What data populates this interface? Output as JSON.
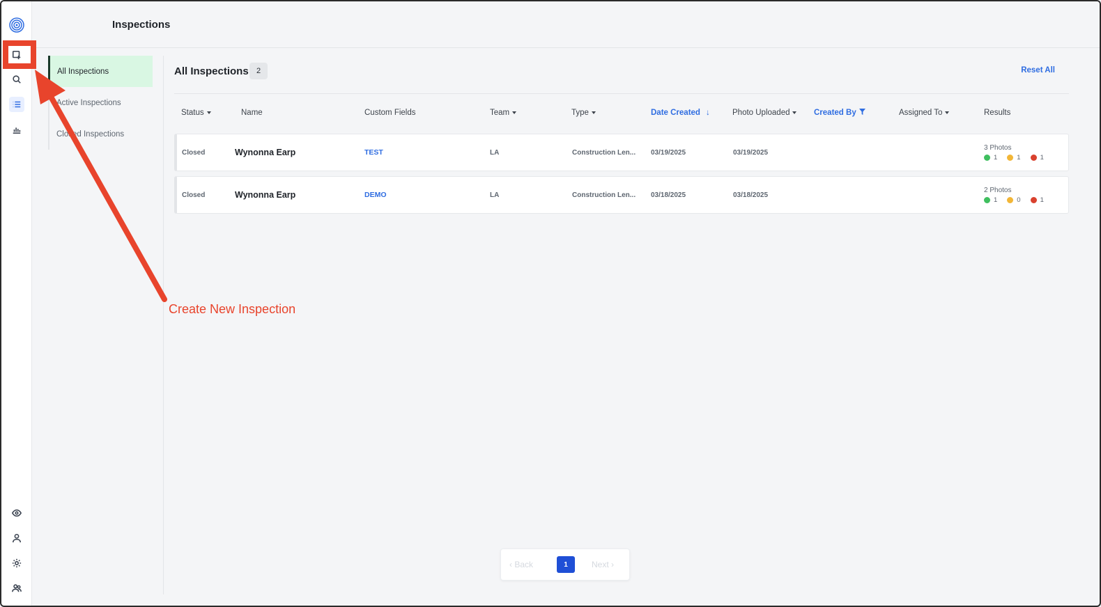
{
  "header": {
    "title": "Inspections"
  },
  "rail": {
    "icons": [
      "logo-icon",
      "create-inspection-icon",
      "search-icon",
      "list-icon",
      "chart-icon",
      "eye-icon",
      "user-icon",
      "gear-icon",
      "team-icon"
    ]
  },
  "subnav": {
    "items": [
      {
        "label": "All Inspections",
        "active": true
      },
      {
        "label": "Active Inspections",
        "active": false
      },
      {
        "label": "Closed Inspections",
        "active": false
      }
    ]
  },
  "main": {
    "heading": "All Inspections",
    "count": "2",
    "reset_label": "Reset All"
  },
  "table": {
    "columns": [
      "Status",
      "Name",
      "Custom Fields",
      "Team",
      "Type",
      "Date Created",
      "Photo Uploaded",
      "Created By",
      "Assigned To",
      "Results"
    ],
    "rows": [
      {
        "status": "Closed",
        "name": "Wynonna Earp",
        "custom_field": "TEST",
        "team": "LA",
        "type": "Construction Len...",
        "date_created": "03/19/2025",
        "photo_uploaded": "03/19/2025",
        "created_by": "",
        "assigned_to": "",
        "photos": "3 Photos",
        "green": "1",
        "yellow": "1",
        "red": "1"
      },
      {
        "status": "Closed",
        "name": "Wynonna Earp",
        "custom_field": "DEMO",
        "team": "LA",
        "type": "Construction Len...",
        "date_created": "03/18/2025",
        "photo_uploaded": "03/18/2025",
        "created_by": "",
        "assigned_to": "",
        "photos": "2 Photos",
        "green": "1",
        "yellow": "0",
        "red": "1"
      }
    ]
  },
  "pagination": {
    "back": "Back",
    "page": "1",
    "next": "Next"
  },
  "annotation": {
    "label": "Create New Inspection"
  },
  "colors": {
    "accent": "#2f6de1",
    "active_nav_bg": "#d9f7e3",
    "annotation": "#e8442c",
    "green": "#3fbf5f",
    "yellow": "#f2b637",
    "red": "#d9412e",
    "page_button": "#1f4fd6"
  }
}
